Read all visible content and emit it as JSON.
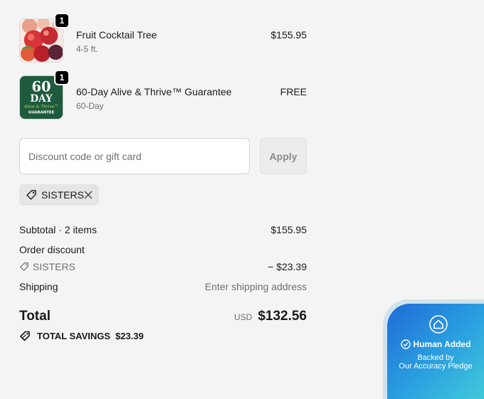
{
  "line_items": [
    {
      "name": "Fruit Cocktail Tree",
      "variant": "4-5 ft.",
      "price": "$155.95",
      "quantity": "1"
    },
    {
      "name": "60-Day Alive & Thrive™ Guarantee",
      "variant": "60-Day",
      "price": "FREE",
      "quantity": "1",
      "thumb_text": {
        "big": "60",
        "day": "DAY",
        "script": "Alive & Thrive™",
        "small": "GUARANTEE"
      }
    }
  ],
  "discount": {
    "placeholder": "Discount code or gift card",
    "apply_label": "Apply",
    "applied_code": "SISTERS"
  },
  "summary": {
    "subtotal_label": "Subtotal · 2 items",
    "subtotal_value": "$155.95",
    "order_discount_label": "Order discount",
    "discount_code": "SISTERS",
    "discount_value": "− $23.39",
    "shipping_label": "Shipping",
    "shipping_value": "Enter shipping address",
    "total_label": "Total",
    "currency": "USD",
    "total_value": "$132.56",
    "savings_label": "TOTAL SAVINGS",
    "savings_value": "$23.39"
  },
  "pledge": {
    "title": "Human Added",
    "line1": "Backed by",
    "line2": "Our Accuracy Pledge"
  },
  "colors": {
    "background": "#f4f4f4",
    "text": "#1a1a1a",
    "muted": "#707070",
    "guarantee_green": "#1e5a3c"
  }
}
